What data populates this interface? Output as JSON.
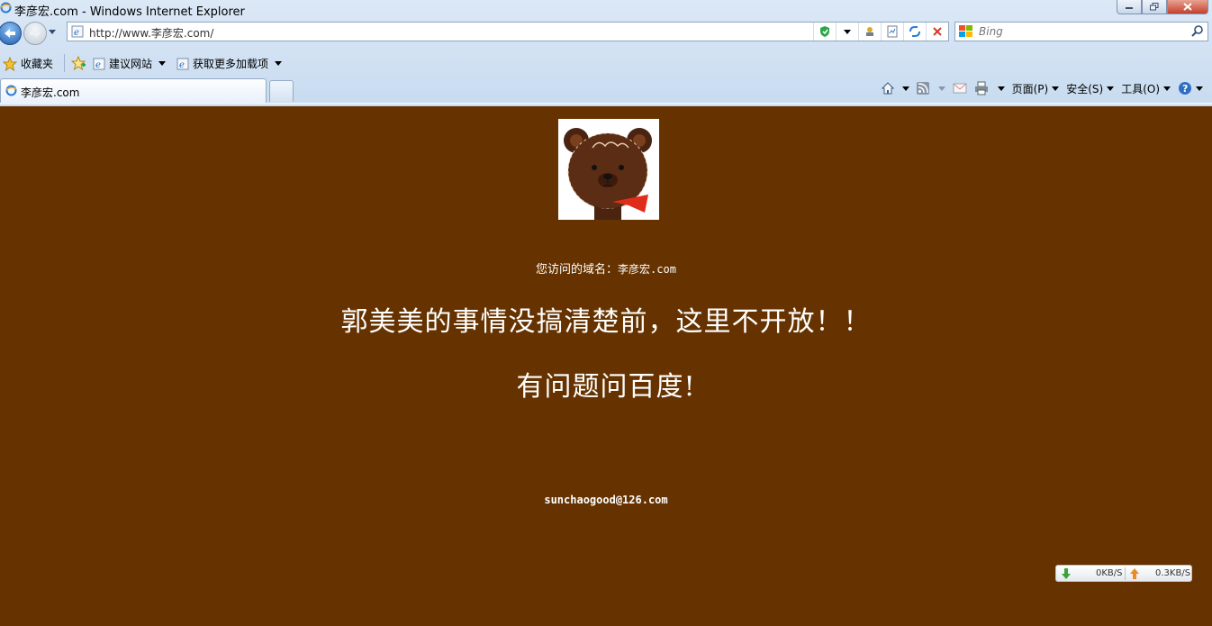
{
  "window": {
    "title": "李彦宏.com - Windows Internet Explorer"
  },
  "address_bar": {
    "url": "http://www.李彦宏.com/"
  },
  "search": {
    "placeholder": "Bing"
  },
  "favorites_bar": {
    "favorites_label": "收藏夹",
    "items": [
      {
        "label": "建议网站"
      },
      {
        "label": "获取更多加载项"
      }
    ]
  },
  "tabs": [
    {
      "label": "李彦宏.com"
    }
  ],
  "command_bar": {
    "page_label": "页面(P)",
    "safety_label": "安全(S)",
    "tools_label": "工具(O)"
  },
  "content": {
    "domain_prefix": "您访问的域名：",
    "domain_value": "李彦宏.com",
    "headline": "郭美美的事情没搞清楚前，这里不开放！！",
    "subheadline": "有问题问百度!",
    "email": "sunchaogood@126.com"
  },
  "net_speed": {
    "download": "0KB/S",
    "upload": "0.3KB/S"
  },
  "colors": {
    "page_background": "#663300",
    "text": "#ffffff",
    "chrome": "#dbe8f6"
  }
}
